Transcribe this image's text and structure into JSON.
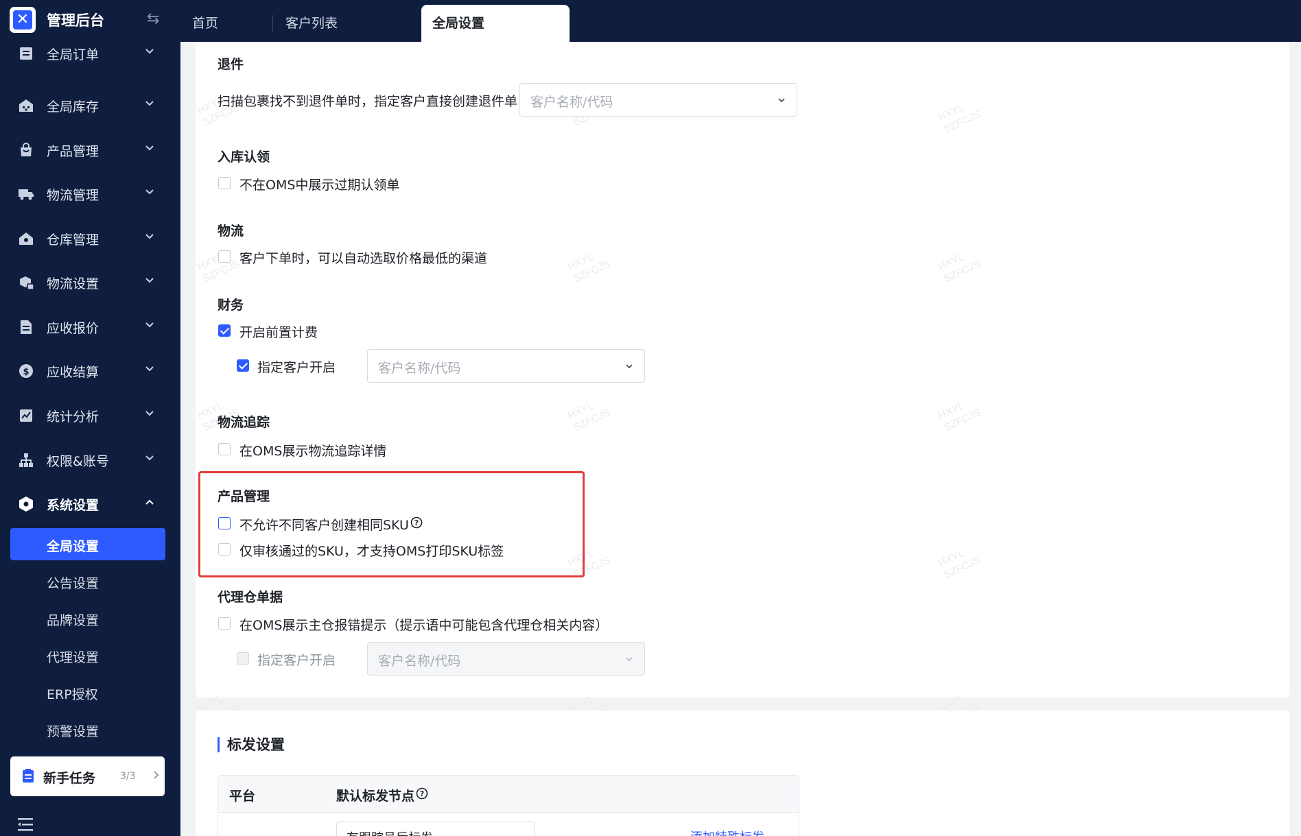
{
  "app": {
    "title": "管理后台"
  },
  "tabs": [
    {
      "label": "首页"
    },
    {
      "label": "客户列表"
    },
    {
      "label": "全局设置"
    }
  ],
  "sidebar": {
    "items": [
      {
        "label": "全局订单",
        "icon": "order-icon"
      },
      {
        "label": "全局库存",
        "icon": "warehouse-icon"
      },
      {
        "label": "产品管理",
        "icon": "bag-icon"
      },
      {
        "label": "物流管理",
        "icon": "truck-icon"
      },
      {
        "label": "仓库管理",
        "icon": "house-icon"
      },
      {
        "label": "物流设置",
        "icon": "package-settings-icon"
      },
      {
        "label": "应收报价",
        "icon": "document-icon"
      },
      {
        "label": "应收结算",
        "icon": "dollar-icon"
      },
      {
        "label": "统计分析",
        "icon": "chart-icon"
      },
      {
        "label": "权限&账号",
        "icon": "org-tree-icon"
      },
      {
        "label": "系统设置",
        "icon": "hexagon-settings-icon"
      }
    ],
    "sub_items": [
      {
        "label": "全局设置"
      },
      {
        "label": "公告设置"
      },
      {
        "label": "品牌设置"
      },
      {
        "label": "代理设置"
      },
      {
        "label": "ERP授权"
      },
      {
        "label": "预警设置"
      }
    ],
    "newbie": {
      "label": "新手任务",
      "count": "3/3"
    }
  },
  "settings": {
    "returns": {
      "title": "退件",
      "text": "扫描包裹找不到退件单时，指定客户直接创建退件单",
      "placeholder": "客户名称/代码"
    },
    "inbound": {
      "title": "入库认领",
      "option": "不在OMS中展示过期认领单"
    },
    "logistics": {
      "title": "物流",
      "option": "客户下单时，可以自动选取价格最低的渠道"
    },
    "finance": {
      "title": "财务",
      "option": "开启前置计费",
      "sub_option": "指定客户开启",
      "placeholder": "客户名称/代码"
    },
    "tracking": {
      "title": "物流追踪",
      "option": "在OMS展示物流追踪详情"
    },
    "product": {
      "title": "产品管理",
      "option1": "不允许不同客户创建相同SKU",
      "option2": "仅审核通过的SKU，才支持OMS打印SKU标签"
    },
    "proxy": {
      "title": "代理仓单据",
      "option": "在OMS展示主仓报错提示（提示语中可能包含代理仓相关内容）",
      "sub_option": "指定客户开启",
      "placeholder": "客户名称/代码"
    }
  },
  "label_settings": {
    "title": "标发设置",
    "columns": [
      "平台",
      "默认标发节点"
    ],
    "row": {
      "node": "有跟踪号后标发",
      "link": "添加特殊标发"
    }
  },
  "watermark": {
    "line1": "HXYL",
    "line2": "SZFCJS"
  },
  "colors": {
    "primary": "#2e5bff",
    "sidebar": "#0f1e3f",
    "highlight": "#e23c3c"
  }
}
